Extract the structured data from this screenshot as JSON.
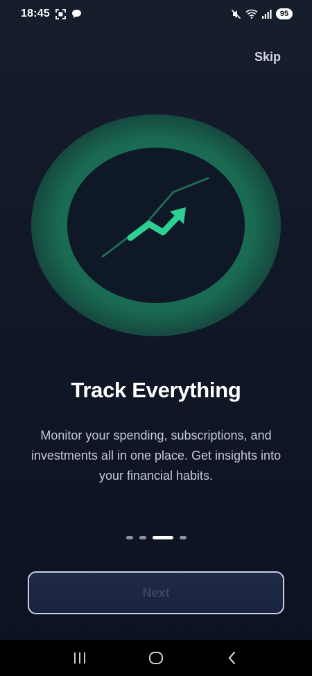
{
  "status_bar": {
    "time": "18:45",
    "battery": "95",
    "icons": [
      "screenshot-icon",
      "chat-icon",
      "mute-icon",
      "wifi-icon",
      "signal-icon"
    ]
  },
  "header": {
    "skip_label": "Skip"
  },
  "hero": {
    "icon": "trending-up-icon",
    "accent_color": "#2ecf95"
  },
  "content": {
    "title": "Track Everything",
    "description": "Monitor your spending, subscriptions, and investments all in one place. Get insights into your financial habits."
  },
  "pagination": {
    "total": 4,
    "active_index": 2
  },
  "actions": {
    "next_label": "Next"
  },
  "nav_bar": {
    "icons": [
      "recents-icon",
      "home-icon",
      "back-icon"
    ]
  }
}
